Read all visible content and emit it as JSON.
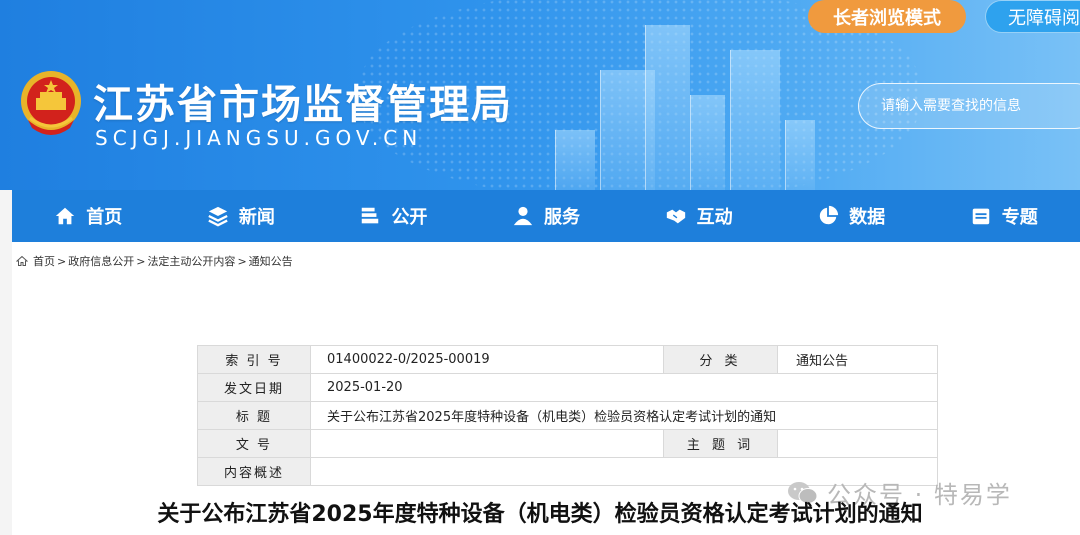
{
  "header": {
    "title": "江苏省市场监督管理局",
    "domain": "SCJGJ.JIANGSU.GOV.CN",
    "elder_mode": "长者浏览模式",
    "accessibility": "无障碍阅读",
    "search_placeholder": "请输入需要查找的信息"
  },
  "nav": {
    "items": [
      {
        "label": "首页",
        "icon": "home-icon"
      },
      {
        "label": "新闻",
        "icon": "layers-icon"
      },
      {
        "label": "公开",
        "icon": "stack-icon"
      },
      {
        "label": "服务",
        "icon": "users-icon"
      },
      {
        "label": "互动",
        "icon": "handshake-icon"
      },
      {
        "label": "数据",
        "icon": "pie-icon"
      },
      {
        "label": "专题",
        "icon": "calendar-icon"
      }
    ]
  },
  "breadcrumb": [
    "首页",
    "政府信息公开",
    "法定主动公开内容",
    "通知公告"
  ],
  "info_table": {
    "index_label": "索 引 号",
    "index_value": "01400022-0/2025-00019",
    "category_label": "分 类",
    "category_value": "通知公告",
    "date_label": "发文日期",
    "date_value": "2025-01-20",
    "title_label": "标 题",
    "title_value": "关于公布江苏省2025年度特种设备（机电类）检验员资格认定考试计划的通知",
    "docno_label": "文 号",
    "docno_value": "",
    "subject_label": "主 题 词",
    "subject_value": "",
    "summary_label": "内容概述",
    "summary_value": ""
  },
  "watermark": "公众号 · 特易学",
  "document_title": "关于公布江苏省2025年度特种设备（机电类）检验员资格认定考试计划的通知",
  "colors": {
    "nav_bg": "#1e7fdb",
    "elder_btn": "#f09a3e",
    "banner": "#2f93ec"
  }
}
